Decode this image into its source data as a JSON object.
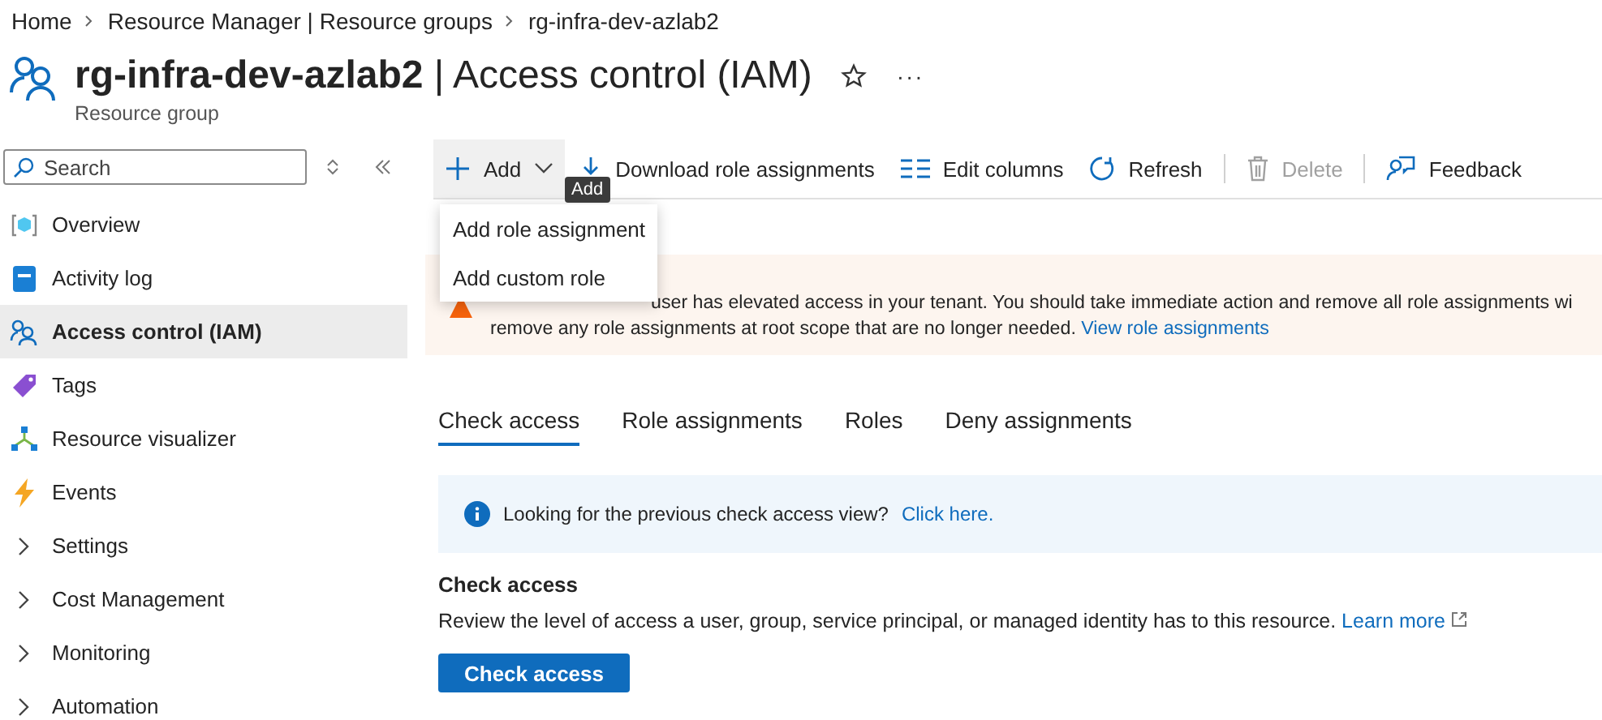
{
  "breadcrumb": [
    {
      "label": "Home"
    },
    {
      "label": "Resource Manager | Resource groups"
    },
    {
      "label": "rg-infra-dev-azlab2"
    }
  ],
  "header": {
    "title": "**rg-infra-dev-azlab2** | Access control (IAM)",
    "subtitle": "Resource group",
    "favorite": false,
    "more": "···"
  },
  "sidebar": {
    "search": {
      "placeholder": "Search"
    },
    "items": [
      {
        "label": "Overview",
        "kind": "page",
        "selected": false
      },
      {
        "label": "Activity log",
        "kind": "page",
        "selected": false
      },
      {
        "label": "Access control (IAM)",
        "kind": "page",
        "selected": true
      },
      {
        "label": "Tags",
        "kind": "page",
        "selected": false
      },
      {
        "label": "Resource visualizer",
        "kind": "page",
        "selected": false
      },
      {
        "label": "Events",
        "kind": "page",
        "selected": false
      },
      {
        "label": "Settings",
        "kind": "group",
        "expanded": false
      },
      {
        "label": "Cost Management",
        "kind": "group",
        "expanded": false
      },
      {
        "label": "Monitoring",
        "kind": "group",
        "expanded": false
      },
      {
        "label": "Automation",
        "kind": "group",
        "expanded": false
      }
    ]
  },
  "toolbar": [
    {
      "label": "Add",
      "kind": "add",
      "disabled": false,
      "expanded": true
    },
    {
      "label": "Download role assignments",
      "kind": "download",
      "disabled": false
    },
    {
      "label": "Edit columns",
      "kind": "columns",
      "disabled": false
    },
    {
      "label": "Refresh",
      "kind": "refresh",
      "disabled": false
    },
    {
      "label": "Delete",
      "kind": "delete",
      "disabled": true
    },
    {
      "label": "Feedback",
      "kind": "feedback",
      "disabled": false
    }
  ],
  "add_menu": {
    "items": [
      {
        "label": "Add role assignment"
      },
      {
        "label": "Add custom role"
      }
    ],
    "tooltip": "Add"
  },
  "banner": {
    "line_1": "user has elevated access in your tenant. You should take immediate action and remove all role assignments wi",
    "line_2": "remove any role assignments at root scope that are no longer needed.",
    "link": "View role assignments"
  },
  "tabs": [
    {
      "label": "Check access",
      "selected": true
    },
    {
      "label": "Role assignments",
      "selected": false
    },
    {
      "label": "Roles",
      "selected": false
    },
    {
      "label": "Deny assignments",
      "selected": false
    }
  ],
  "info": {
    "text": "Looking for the previous check access view?",
    "link": "Click here."
  },
  "check_access": {
    "title": "Check access",
    "description": "Review the level of access a user, group, service principal, or managed identity has to this resource.",
    "link": "Learn more",
    "button": "Check access"
  }
}
